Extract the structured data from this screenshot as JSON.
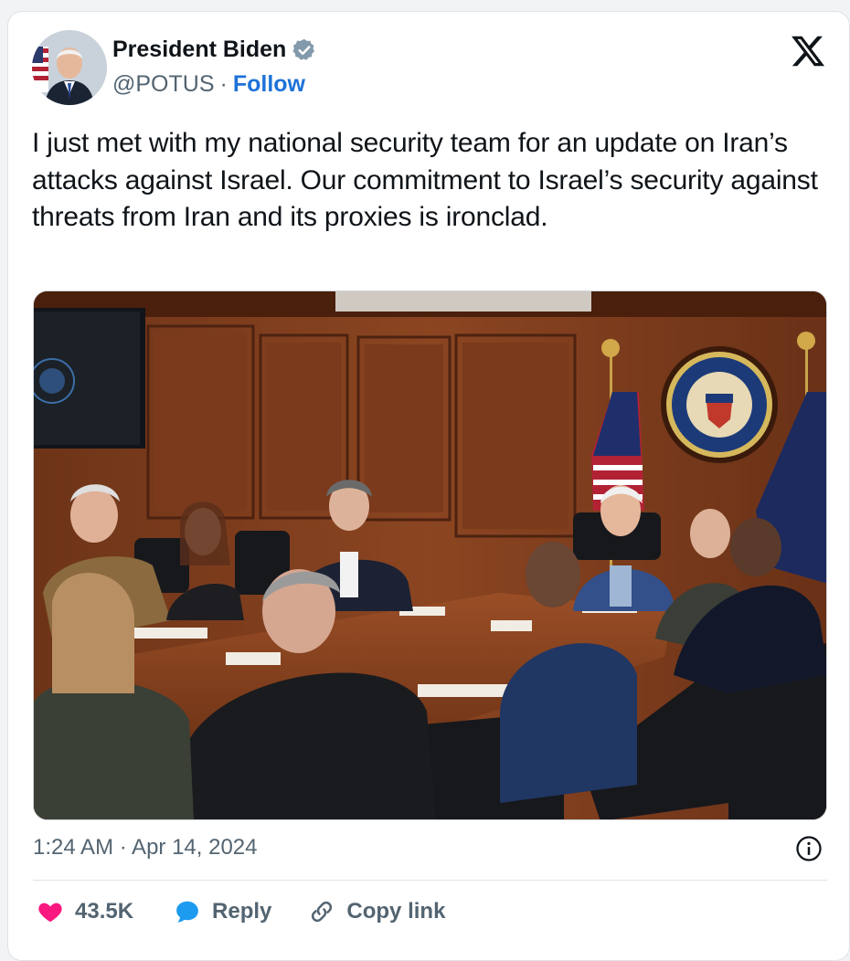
{
  "author": {
    "display_name": "President Biden",
    "handle": "@POTUS",
    "separator": "·",
    "follow_label": "Follow",
    "verified_badge_color": "#829aab"
  },
  "tweet": {
    "text": "I just met with my national security team for an update on Iran’s attacks against Israel. Our commitment to Israel’s security against threats from Iran and its proxies is ironclad.",
    "timestamp": "1:24 AM · Apr 14, 2024"
  },
  "photo": {
    "seal_text_top": "PRESIDENT OF THE UNITED",
    "seal_text_bottom": "SEAL OF THE • STATES •"
  },
  "actions": {
    "likes_count": "43.5K",
    "reply_label": "Reply",
    "copy_link_label": "Copy link"
  },
  "colors": {
    "accent": "#1d72d8",
    "heart": "#f91880",
    "reply_bubble": "#1d9bf0",
    "muted_text": "#536471"
  },
  "icons": {
    "platform_logo": "x-logo-icon",
    "verified": "verified-badge-icon",
    "info": "info-icon",
    "like": "heart-icon",
    "reply": "speech-bubble-icon",
    "copy_link": "link-icon"
  }
}
